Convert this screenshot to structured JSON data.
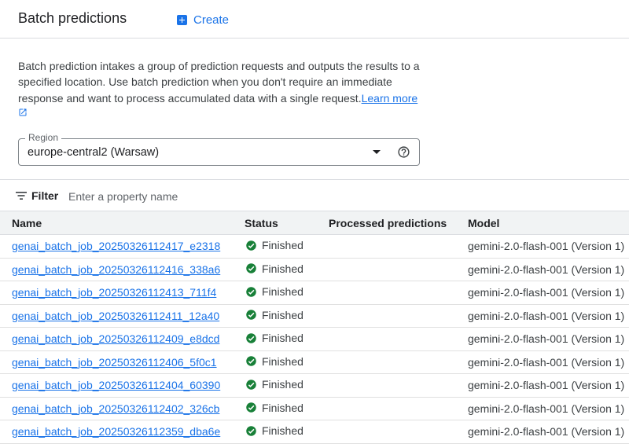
{
  "header": {
    "title": "Batch predictions",
    "create_label": "Create"
  },
  "description": {
    "text": "Batch prediction intakes a group of prediction requests and outputs the results to a specified location. Use batch prediction when you don't require an immediate response and want to process accumulated data with a single request.",
    "learn_more": "Learn more"
  },
  "region": {
    "label": "Region",
    "value": "europe-central2 (Warsaw)"
  },
  "filter": {
    "label": "Filter",
    "placeholder": "Enter a property name"
  },
  "table": {
    "columns": {
      "name": "Name",
      "status": "Status",
      "processed": "Processed predictions",
      "model": "Model"
    },
    "rows": [
      {
        "name": "genai_batch_job_20250326112417_e2318",
        "status": "Finished",
        "processed": "",
        "model": "gemini-2.0-flash-001 (Version 1)"
      },
      {
        "name": "genai_batch_job_20250326112416_338a6",
        "status": "Finished",
        "processed": "",
        "model": "gemini-2.0-flash-001 (Version 1)"
      },
      {
        "name": "genai_batch_job_20250326112413_711f4",
        "status": "Finished",
        "processed": "",
        "model": "gemini-2.0-flash-001 (Version 1)"
      },
      {
        "name": "genai_batch_job_20250326112411_12a40",
        "status": "Finished",
        "processed": "",
        "model": "gemini-2.0-flash-001 (Version 1)"
      },
      {
        "name": "genai_batch_job_20250326112409_e8dcd",
        "status": "Finished",
        "processed": "",
        "model": "gemini-2.0-flash-001 (Version 1)"
      },
      {
        "name": "genai_batch_job_20250326112406_5f0c1",
        "status": "Finished",
        "processed": "",
        "model": "gemini-2.0-flash-001 (Version 1)"
      },
      {
        "name": "genai_batch_job_20250326112404_60390",
        "status": "Finished",
        "processed": "",
        "model": "gemini-2.0-flash-001 (Version 1)"
      },
      {
        "name": "genai_batch_job_20250326112402_326cb",
        "status": "Finished",
        "processed": "",
        "model": "gemini-2.0-flash-001 (Version 1)"
      },
      {
        "name": "genai_batch_job_20250326112359_dba6e",
        "status": "Finished",
        "processed": "",
        "model": "gemini-2.0-flash-001 (Version 1)"
      }
    ]
  },
  "colors": {
    "accent": "#1a73e8",
    "success": "#188038"
  },
  "icons": {
    "create": "add-box-icon",
    "external": "open-in-new-icon",
    "dropdown": "arrow-drop-down-icon",
    "help": "help-icon",
    "filter": "filter-list-icon",
    "status": "check-circle-icon"
  }
}
